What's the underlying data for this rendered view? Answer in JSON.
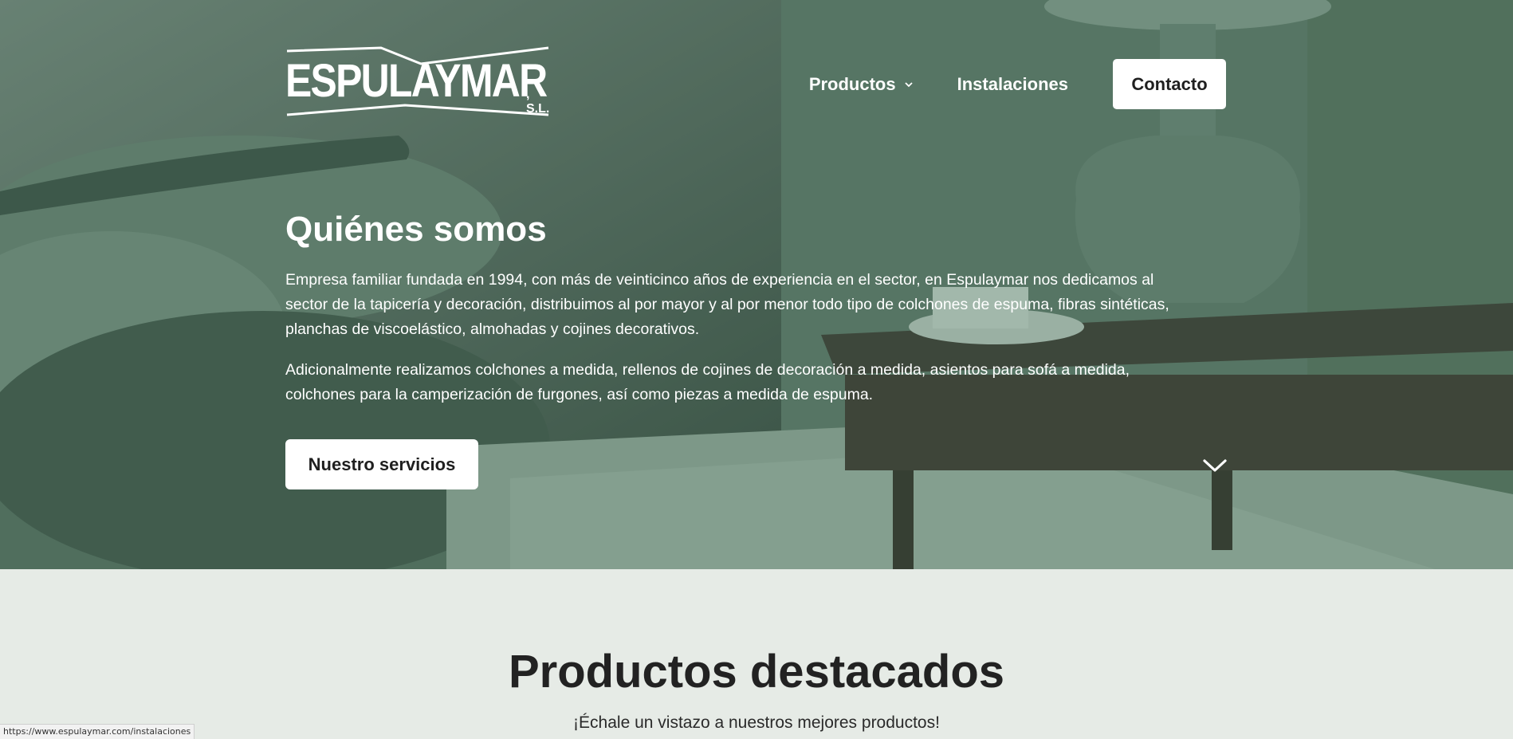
{
  "logo": {
    "wordmark": "ESPULAYMAR",
    "suffix": ", S.L."
  },
  "nav": {
    "items": [
      {
        "label": "Productos",
        "has_dropdown": true
      },
      {
        "label": "Instalaciones",
        "has_dropdown": false
      }
    ],
    "contact_label": "Contacto"
  },
  "hero": {
    "title": "Quiénes somos",
    "paragraph_1": "Empresa familiar fundada en 1994, con más de veinticinco años de experiencia en el sector, en Espulaymar nos dedicamos al sector de la tapicería y decoración, distribuimos al por mayor y al por menor todo tipo de colchones de espuma, fibras sintéticas, planchas de viscoelástico, almohadas y cojines decorativos.",
    "paragraph_2": "Adicionalmente realizamos colchones a medida, rellenos de cojines de decoración a medida, asientos para sofá a medida, colchones para la camperización de furgones, así como piezas a medida de espuma.",
    "cta_label": "Nuestro servicios",
    "scroll_icon": "chevron-down-icon"
  },
  "featured": {
    "title": "Productos destacados",
    "subtitle": "¡Échale un vistazo a nuestros mejores productos!"
  },
  "status_bar": {
    "url": "https://www.espulaymar.com/instalaciones"
  },
  "colors": {
    "hero_tint": "#4e6a5a",
    "section_bg": "#e6ebe6",
    "button_bg": "#ffffff",
    "text_dark": "#222222"
  }
}
